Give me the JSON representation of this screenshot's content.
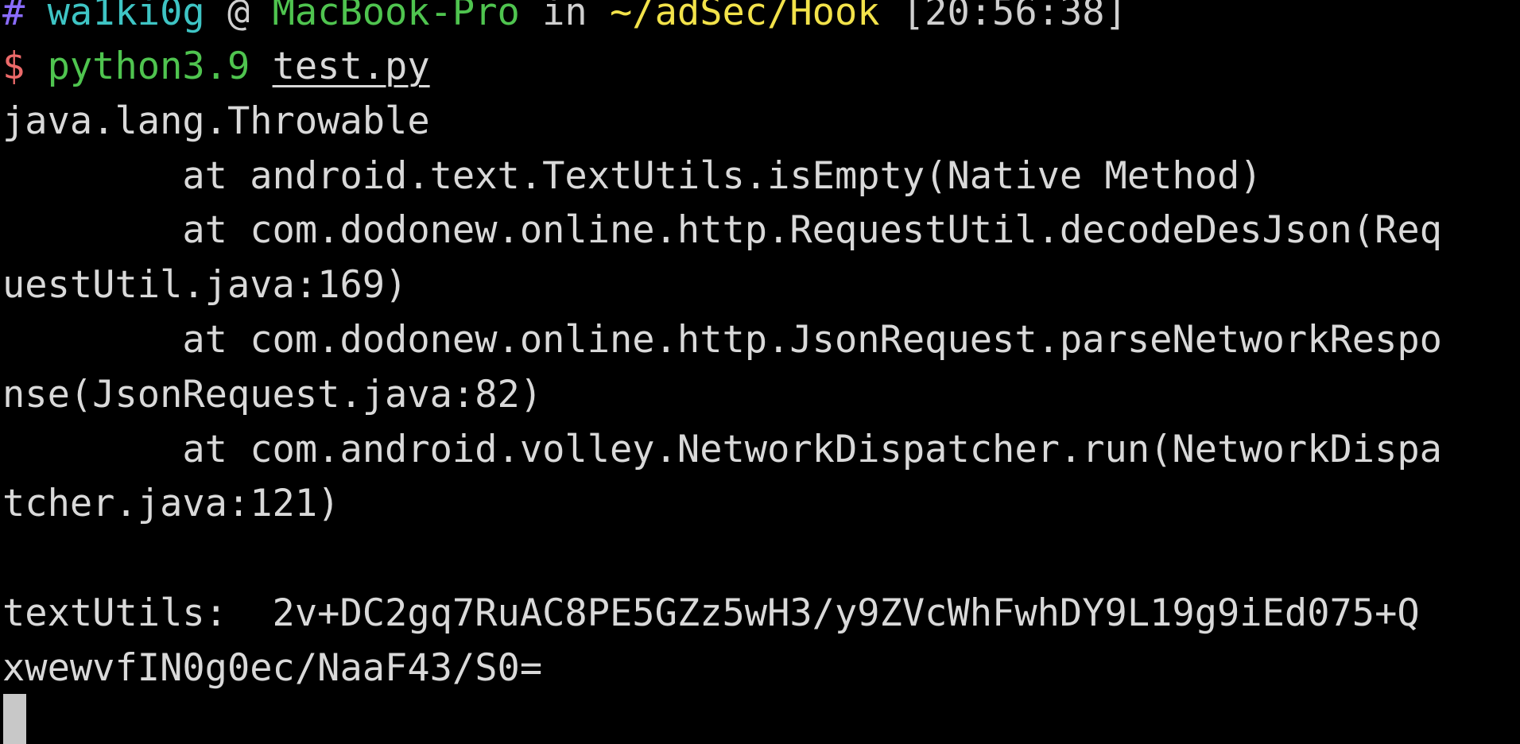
{
  "prompt": {
    "hash": "#",
    "user": "wa1ki0g",
    "at": "@",
    "host": "MacBook-Pro",
    "in": "in",
    "path": "~/adSec/Hook",
    "time": "[20:56:38]"
  },
  "command": {
    "dollar": "$",
    "program": "python3.9",
    "argument": "test.py"
  },
  "output_lines": [
    "java.lang.Throwable",
    "        at android.text.TextUtils.isEmpty(Native Method)",
    "        at com.dodonew.online.http.RequestUtil.decodeDesJson(Req",
    "uestUtil.java:169)",
    "        at com.dodonew.online.http.JsonRequest.parseNetworkRespo",
    "nse(JsonRequest.java:82)",
    "        at com.android.volley.NetworkDispatcher.run(NetworkDispa",
    "tcher.java:121)",
    "textUtils:  2v+DC2gq7RuAC8PE5GZz5wH3/y9ZVcWhFwhDY9L19g9iEd075+Q",
    "xwewvfIN0g0ec/NaaF43/S0="
  ]
}
